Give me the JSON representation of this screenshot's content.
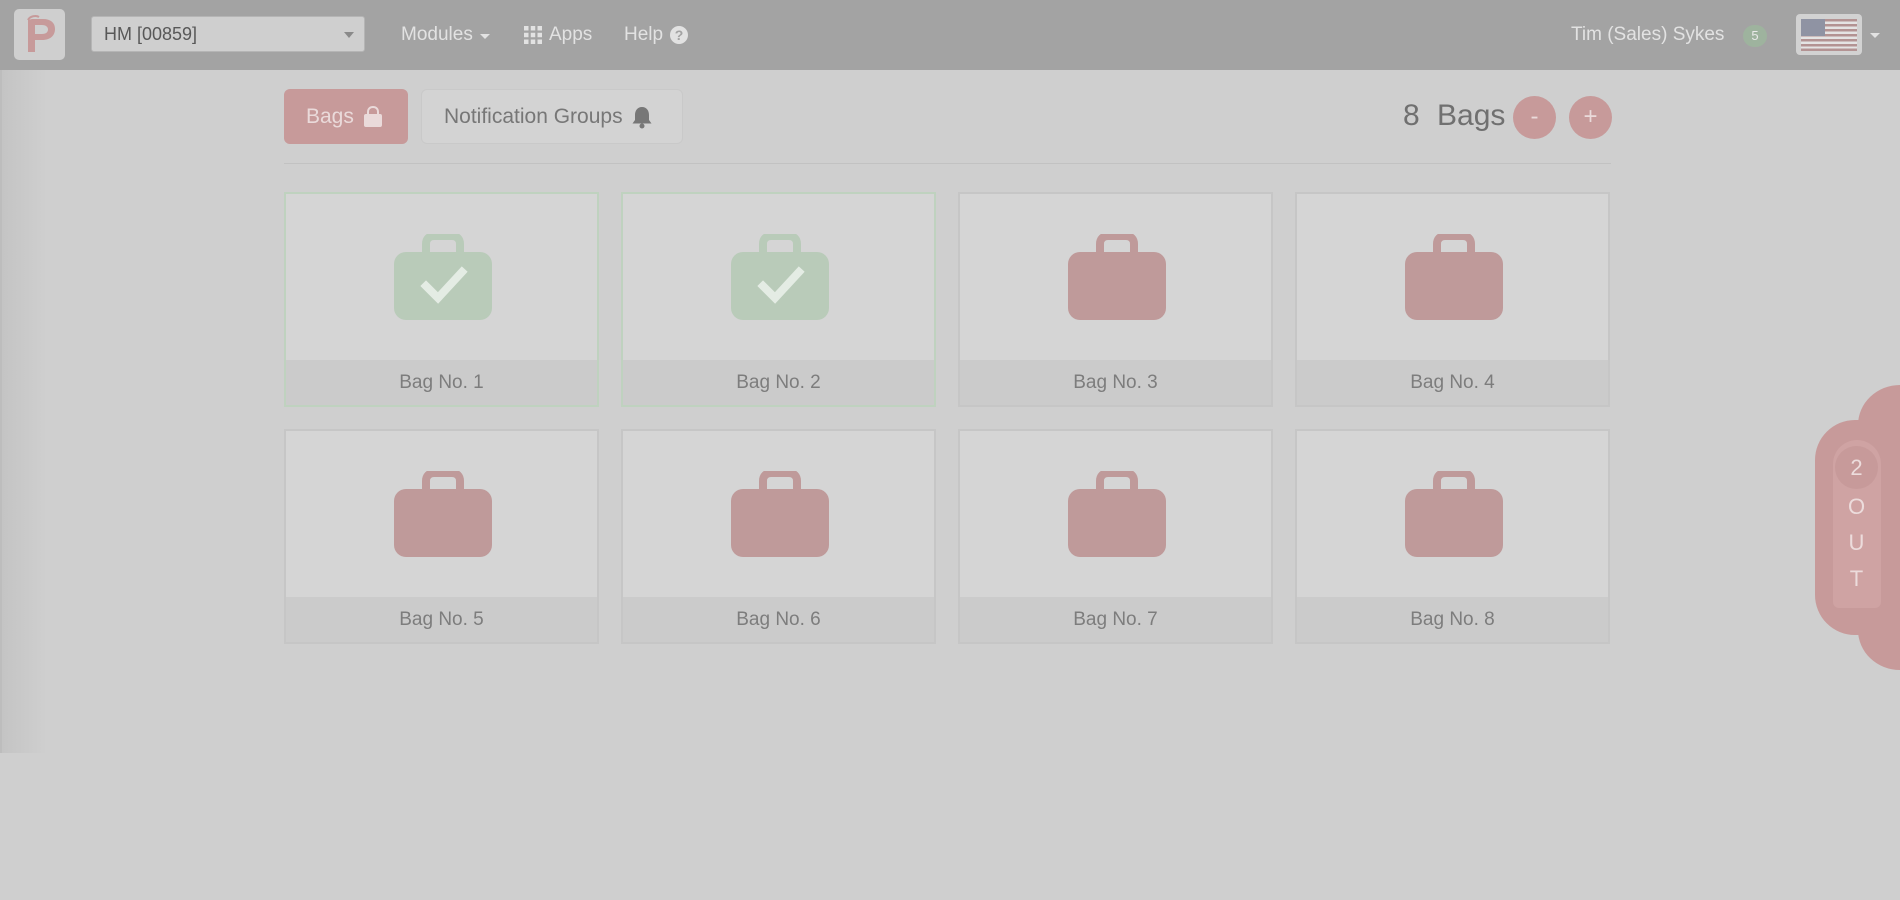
{
  "header": {
    "site_select_value": "HM [00859]",
    "nav": {
      "modules_label": "Modules",
      "apps_label": "Apps",
      "help_label": "Help"
    },
    "user": {
      "name": "Tim (Sales) Sykes",
      "badge_count": "5"
    }
  },
  "toolbar": {
    "tabs": [
      {
        "label": "Bags",
        "active": true
      },
      {
        "label": "Notification Groups",
        "active": false
      }
    ],
    "bag_count": "8",
    "bag_count_label": "Bags",
    "decrement_label": "-",
    "increment_label": "+"
  },
  "bags": [
    {
      "label": "Bag No. 1",
      "status": "done"
    },
    {
      "label": "Bag No. 2",
      "status": "done"
    },
    {
      "label": "Bag No. 3",
      "status": "pending"
    },
    {
      "label": "Bag No. 4",
      "status": "pending"
    },
    {
      "label": "Bag No. 5",
      "status": "pending"
    },
    {
      "label": "Bag No. 6",
      "status": "pending"
    },
    {
      "label": "Bag No. 7",
      "status": "pending"
    },
    {
      "label": "Bag No. 8",
      "status": "pending"
    }
  ],
  "side_tab": {
    "count": "2",
    "letters": [
      "O",
      "U",
      "T"
    ]
  },
  "colors": {
    "accent": "#c79a9a",
    "done": "#b9cbb9",
    "pending": "#bf9a9a"
  }
}
